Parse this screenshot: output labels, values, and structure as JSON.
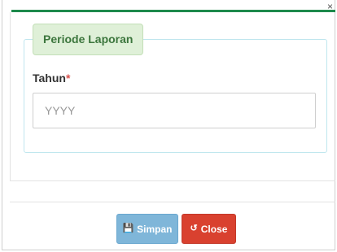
{
  "modal": {
    "close_glyph": "×"
  },
  "form": {
    "legend": "Periode Laporan",
    "year_label": "Tahun",
    "required_mark": "*",
    "year_placeholder": "YYYY",
    "year_value": ""
  },
  "footer": {
    "save_label": "Simpan",
    "save_icon": "floppy-disk-icon",
    "close_label": "Close",
    "close_icon": "undo-icon"
  },
  "colors": {
    "accent_bar": "#1e8a4c",
    "legend_bg": "#dff0d8",
    "legend_text": "#3c763d",
    "save_button": "#7fb6d9",
    "close_button": "#d9412f"
  }
}
